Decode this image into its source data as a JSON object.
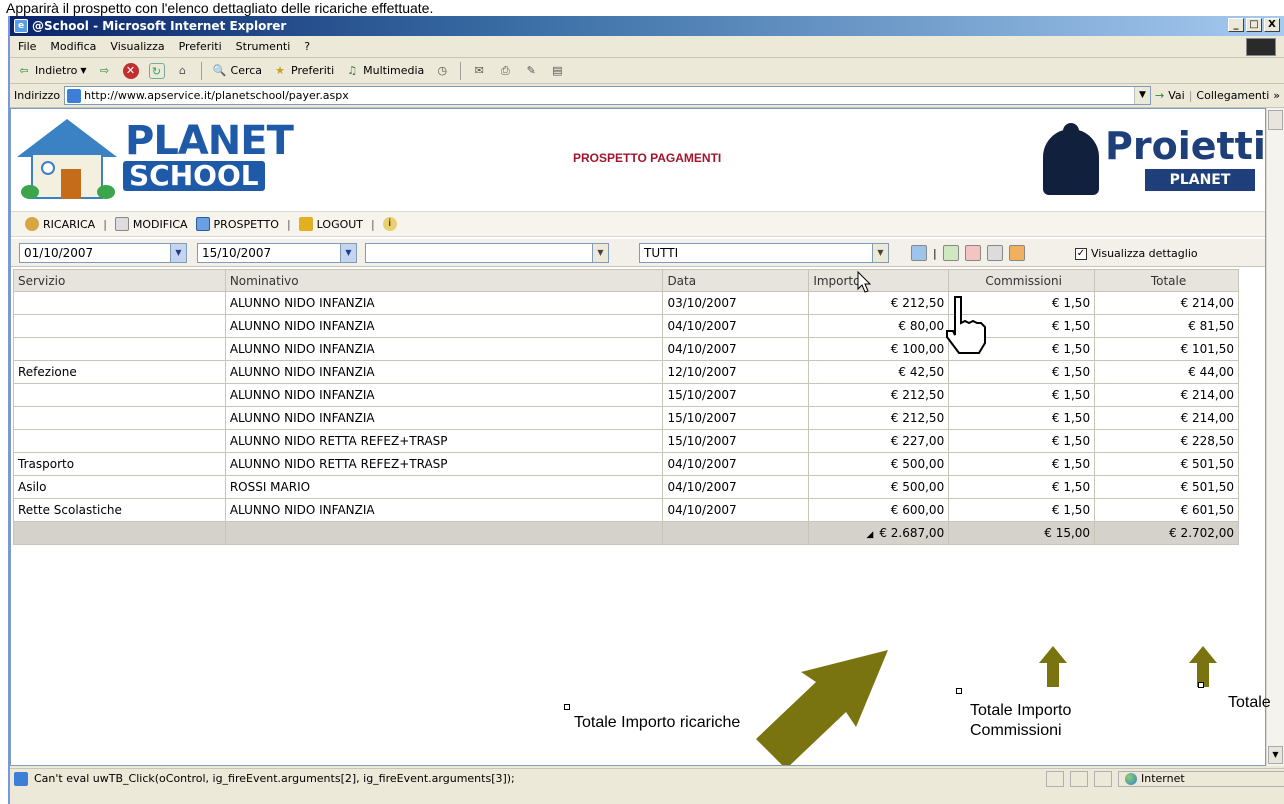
{
  "caption": "Apparirà il prospetto con l'elenco dettagliato delle ricariche effettuate.",
  "window": {
    "title": "@School - Microsoft Internet Explorer",
    "buttons": [
      "_",
      "□",
      "X"
    ]
  },
  "menu": [
    "File",
    "Modifica",
    "Visualizza",
    "Preferiti",
    "Strumenti",
    "?"
  ],
  "toolbar": {
    "back": "Indietro",
    "search": "Cerca",
    "favorites": "Preferiti",
    "multimedia": "Multimedia"
  },
  "address": {
    "label": "Indirizzo",
    "url": "http://www.apservice.it/planetschool/payer.aspx",
    "go": "Vai",
    "links": "Collegamenti"
  },
  "page": {
    "logo_top": "PLANET",
    "logo_bottom": "SCHOOL",
    "title": "PROSPETTO PAGAMENTI",
    "brand": "Proietti",
    "brand_sub": "PLANET"
  },
  "nav": {
    "ricarica": "RICARICA",
    "modifica": "MODIFICA",
    "prospetto": "PROSPETTO",
    "logout": "LOGOUT",
    "sep": "|"
  },
  "filters": {
    "date_from": "01/10/2007",
    "date_to": "15/10/2007",
    "name": "",
    "service": "TUTTI",
    "detail_label": "Visualizza dettaglio",
    "detail_checked": true
  },
  "table": {
    "headers": [
      "Servizio",
      "Nominativo",
      "Data",
      "Importo",
      "Commissioni",
      "Totale"
    ],
    "rows": [
      {
        "servizio": "",
        "nominativo": "ALUNNO NIDO INFANZIA",
        "data": "03/10/2007",
        "importo": "€ 212,50",
        "commissioni": "€ 1,50",
        "totale": "€ 214,00"
      },
      {
        "servizio": "",
        "nominativo": "ALUNNO NIDO INFANZIA",
        "data": "04/10/2007",
        "importo": "€ 80,00",
        "commissioni": "€ 1,50",
        "totale": "€ 81,50"
      },
      {
        "servizio": "",
        "nominativo": "ALUNNO NIDO INFANZIA",
        "data": "04/10/2007",
        "importo": "€ 100,00",
        "commissioni": "€ 1,50",
        "totale": "€ 101,50"
      },
      {
        "servizio": "Refezione",
        "nominativo": "ALUNNO NIDO INFANZIA",
        "data": "12/10/2007",
        "importo": "€ 42,50",
        "commissioni": "€ 1,50",
        "totale": "€ 44,00"
      },
      {
        "servizio": "",
        "nominativo": "ALUNNO NIDO INFANZIA",
        "data": "15/10/2007",
        "importo": "€ 212,50",
        "commissioni": "€ 1,50",
        "totale": "€ 214,00"
      },
      {
        "servizio": "",
        "nominativo": "ALUNNO NIDO INFANZIA",
        "data": "15/10/2007",
        "importo": "€ 212,50",
        "commissioni": "€ 1,50",
        "totale": "€ 214,00"
      },
      {
        "servizio": "",
        "nominativo": "ALUNNO NIDO RETTA REFEZ+TRASP",
        "data": "15/10/2007",
        "importo": "€ 227,00",
        "commissioni": "€ 1,50",
        "totale": "€ 228,50"
      },
      {
        "servizio": "Trasporto",
        "nominativo": "ALUNNO NIDO RETTA REFEZ+TRASP",
        "data": "04/10/2007",
        "importo": "€ 500,00",
        "commissioni": "€ 1,50",
        "totale": "€ 501,50"
      },
      {
        "servizio": "Asilo",
        "nominativo": "ROSSI MARIO",
        "data": "04/10/2007",
        "importo": "€ 500,00",
        "commissioni": "€ 1,50",
        "totale": "€ 501,50"
      },
      {
        "servizio": "Rette Scolastiche",
        "nominativo": "ALUNNO NIDO INFANZIA",
        "data": "04/10/2007",
        "importo": "€ 600,00",
        "commissioni": "€ 1,50",
        "totale": "€ 601,50"
      }
    ],
    "totals": {
      "importo": "€ 2.687,00",
      "commissioni": "€ 15,00",
      "totale": "€ 2.702,00"
    }
  },
  "callouts": {
    "importo": "Totale Importo ricariche",
    "commissioni_1": "Totale Importo",
    "commissioni_2": "Commissioni",
    "totale": "Totale"
  },
  "status": {
    "text": "Can't eval uwTB_Click(oControl, ig_fireEvent.arguments[2], ig_fireEvent.arguments[3]);",
    "zone": "Internet"
  },
  "colors": {
    "callout_arrow": "#7a7410",
    "title_red": "#a3152e"
  }
}
